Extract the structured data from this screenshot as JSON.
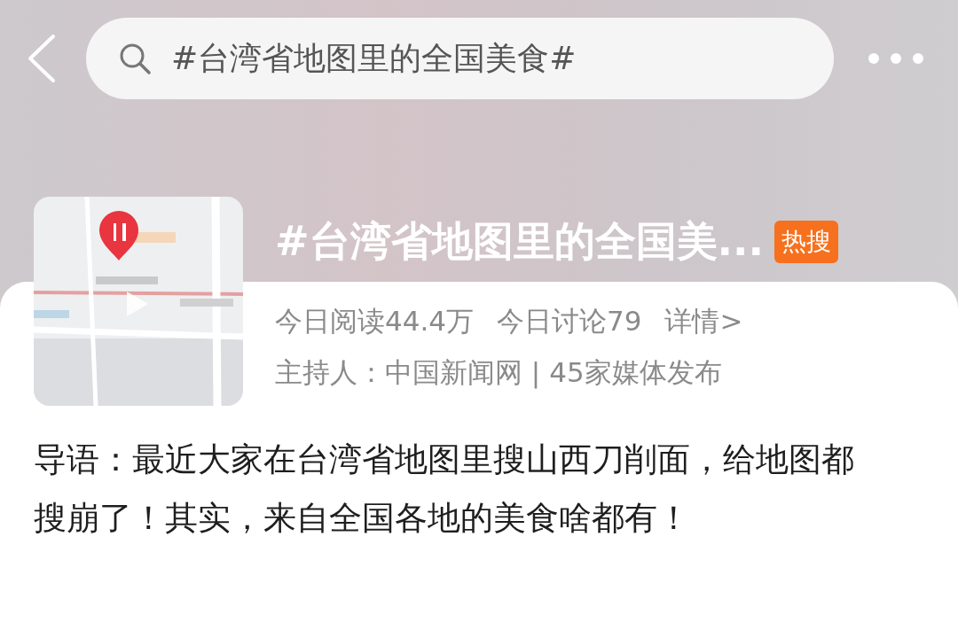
{
  "search": {
    "value": "#台湾省地图里的全国美食#"
  },
  "topic": {
    "thumbnail": {
      "kind": "picture",
      "video": true
    },
    "title": "#台湾省地图里的全国美...",
    "badge": {
      "kind": "hot",
      "label": "热搜"
    }
  },
  "stats": [
    "今日阅读44.4万",
    "今日讨论79"
  ],
  "details_link": "详情>",
  "host_line": "主持人：中国新闻网 | 45家媒体发布",
  "intro": "导语：最近大家在台湾省地图里搜山西刀削面，给地图都搜崩了！其实，来自全国各地的美食啥都有！"
}
